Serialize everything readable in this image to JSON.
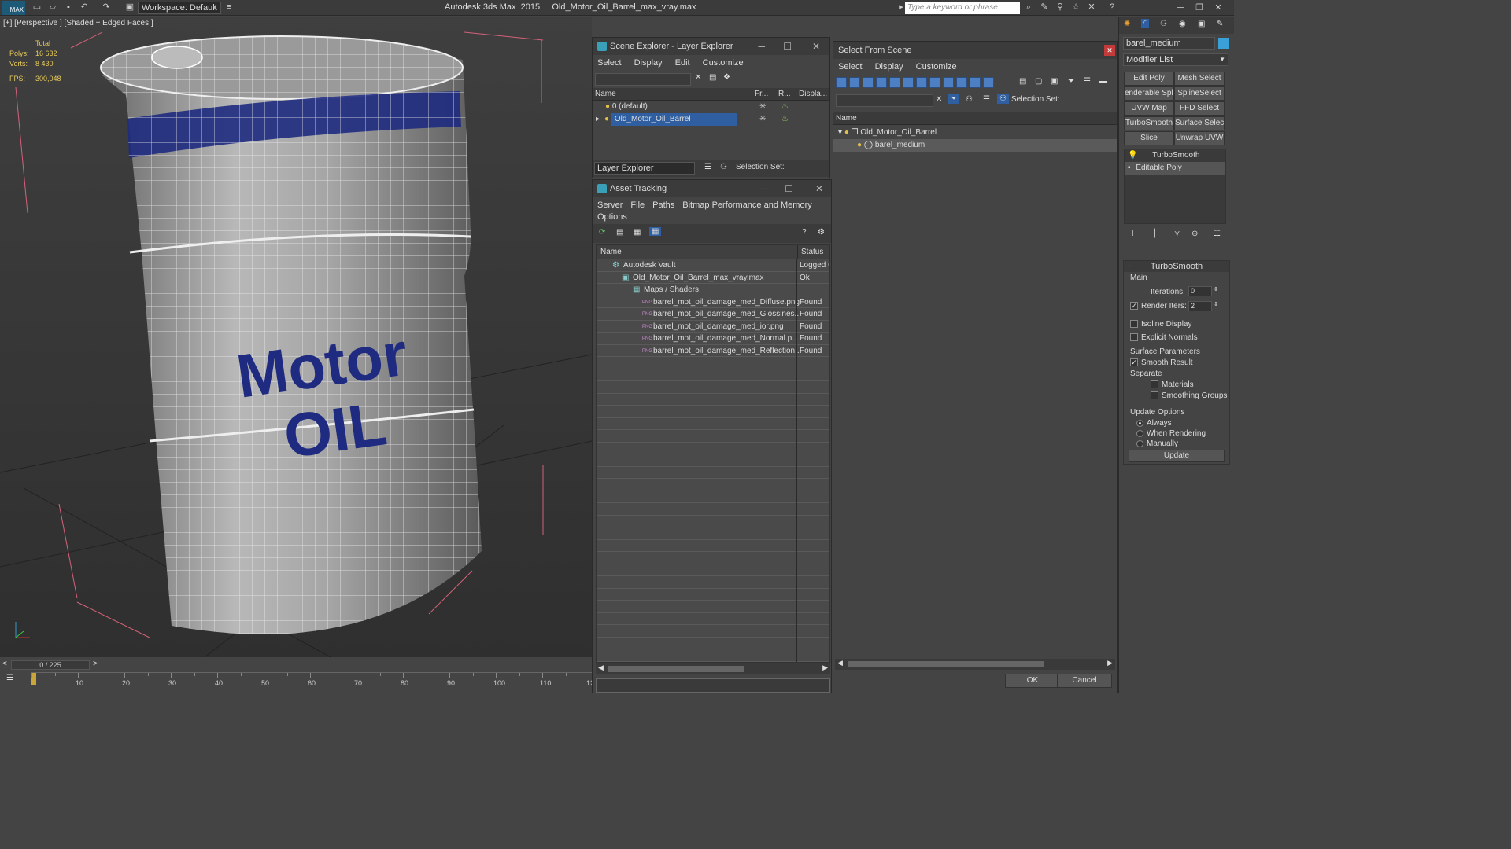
{
  "app": {
    "title": "Autodesk 3ds Max  2015     Old_Motor_Oil_Barrel_max_vray.max",
    "logo": "MAX",
    "workspace": "Workspace: Default",
    "search_placeholder": "Type a keyword or phrase"
  },
  "viewport": {
    "label": "[+] [Perspective ] [Shaded + Edged Faces ]",
    "stats": {
      "total": "Total",
      "polys_label": "Polys:",
      "polys": "16 632",
      "verts_label": "Verts:",
      "verts": "8 430",
      "fps_label": "FPS:",
      "fps": "300,048"
    },
    "barrel_text_1": "Motor",
    "barrel_text_2": "OIL"
  },
  "timeline": {
    "frame": "0 / 225",
    "ticks": [
      "10",
      "20",
      "30",
      "40",
      "50",
      "60",
      "70",
      "80",
      "90",
      "100",
      "110",
      "12"
    ]
  },
  "scene_explorer": {
    "title": "Scene Explorer - Layer Explorer",
    "menu": [
      "Select",
      "Display",
      "Edit",
      "Customize"
    ],
    "columns": [
      "Name",
      "Fr...",
      "R...",
      "Displa..."
    ],
    "rows": [
      "0 (default)",
      "Old_Motor_Oil_Barrel"
    ],
    "footer_dropdown": "Layer Explorer",
    "selection_set": "Selection Set:"
  },
  "asset_tracking": {
    "title": "Asset Tracking",
    "menu": [
      "Server",
      "File",
      "Paths",
      "Bitmap Performance and Memory"
    ],
    "menu2": "Options",
    "columns": [
      "Name",
      "Status"
    ],
    "rows": [
      {
        "name": "Autodesk Vault",
        "status": "Logged O"
      },
      {
        "name": "Old_Motor_Oil_Barrel_max_vray.max",
        "status": "Ok"
      },
      {
        "name": "Maps / Shaders",
        "status": ""
      },
      {
        "name": "barrel_mot_oil_damage_med_Diffuse.png",
        "status": "Found"
      },
      {
        "name": "barrel_mot_oil_damage_med_Glossines...",
        "status": "Found"
      },
      {
        "name": "barrel_mot_oil_damage_med_ior.png",
        "status": "Found"
      },
      {
        "name": "barrel_mot_oil_damage_med_Normal.p...",
        "status": "Found"
      },
      {
        "name": "barrel_mot_oil_damage_med_Reflection...",
        "status": "Found"
      }
    ]
  },
  "select_from_scene": {
    "title": "Select From Scene",
    "menu": [
      "Select",
      "Display",
      "Customize"
    ],
    "selection_set": "Selection Set:",
    "col_name": "Name",
    "tree": [
      "Old_Motor_Oil_Barrel",
      "barel_medium"
    ],
    "ok": "OK",
    "cancel": "Cancel"
  },
  "command_panel": {
    "object_name": "barel_medium",
    "modifier_list": "Modifier List",
    "buttons": [
      "Edit Poly",
      "Mesh Select",
      "enderable Splir",
      "SplineSelect",
      "UVW Map",
      "FFD Select",
      "TurboSmooth",
      "Surface Select",
      "Slice",
      "Unwrap UVW"
    ],
    "stack": [
      "TurboSmooth",
      "Editable Poly"
    ],
    "rollout": {
      "title": "TurboSmooth",
      "main": "Main",
      "iterations_label": "Iterations:",
      "iterations": "0",
      "render_iters_label": "Render Iters:",
      "render_iters": "2",
      "isoline": "Isoline Display",
      "explicit": "Explicit Normals",
      "surface_params": "Surface Parameters",
      "smooth_result": "Smooth Result",
      "separate": "Separate",
      "materials": "Materials",
      "smoothing_groups": "Smoothing Groups",
      "update_options": "Update Options",
      "always": "Always",
      "when_rendering": "When Rendering",
      "manually": "Manually",
      "update": "Update"
    }
  },
  "colors": {
    "selection": "#2f5fa0",
    "accent": "#3aa0b8",
    "stats": "#e6c95a"
  }
}
